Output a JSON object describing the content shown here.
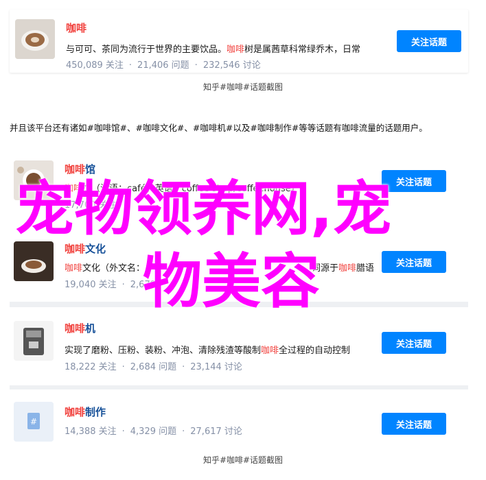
{
  "card1": {
    "title": "咖啡",
    "desc_pre": "与可可、茶同为流行于世界的主要饮品。",
    "desc_hl": "咖啡",
    "desc_post": "树是属茜草科常绿乔木，日常",
    "followers": "450,089 关注",
    "questions": "21,406 问题",
    "discussions": "232,546 讨论",
    "button": "关注话题"
  },
  "caption_top": "知乎#咖啡#话题截图",
  "intro": "并且该平台还有诸如#咖啡馆#、#咖啡文化#、#咖啡机#以及#咖啡制作#等等话题有咖啡流量的话题用户。",
  "items": [
    {
      "title_hl": "咖啡",
      "title_rest": "馆",
      "desc_hl": "咖啡",
      "desc_post": "馆（法语：café，英语：coffee shop/coffeehouse)",
      "followers": "17,700 关注",
      "questions": "",
      "discussions": "",
      "button": "关注话题"
    },
    {
      "title_hl": "咖啡",
      "title_rest": "文化",
      "desc_hl": "咖啡",
      "desc_post": "文化（外文名：",
      "desc_tail": "词源于",
      "desc_tail_hl": "咖啡",
      "desc_tail_post": "腊语",
      "followers": "19,040 关注",
      "questions": "2,679",
      "discussions": "",
      "button": "关注话题"
    },
    {
      "title_hl": "咖啡",
      "title_rest": "机",
      "desc_pre": "实现了磨粉、压粉、装粉、冲泡、清除残渣等酸制",
      "desc_hl": "咖啡",
      "desc_post": "全过程的自动控制",
      "followers": "18,222 关注",
      "questions": "2,684 问题",
      "discussions": "23,144 讨论",
      "button": "关注话题"
    },
    {
      "title_hl": "咖啡",
      "title_rest": "制作",
      "followers": "14,388 关注",
      "questions": "4,329 问题",
      "discussions": "27,617 讨论",
      "button": "关注话题"
    }
  ],
  "caption_bottom": "知乎#咖啡#话题截图",
  "overlay": {
    "line1": "宠物领养网,宠",
    "line2": "物美容"
  },
  "colors": {
    "accent": "#0084ff",
    "highlight": "#f1403c",
    "link": "#175199",
    "overlay": "#ff00ff"
  }
}
